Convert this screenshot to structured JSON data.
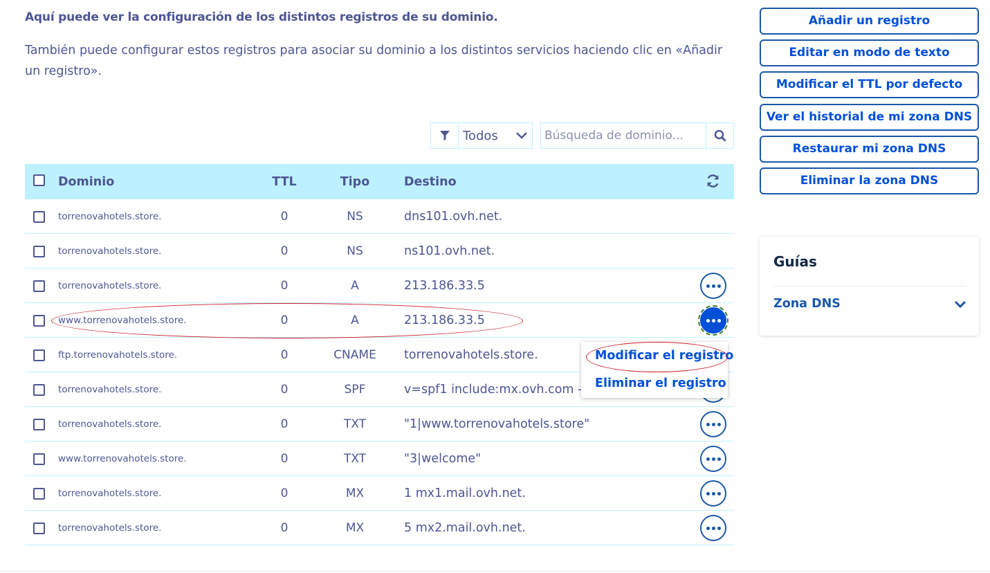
{
  "intro": {
    "title": "Aquí puede ver la configuración de los distintos registros de su dominio.",
    "text": "También puede configurar estos registros para asociar su dominio a los distintos servicios haciendo clic en «Añadir un registro»."
  },
  "filter": {
    "selected": "Todos",
    "icon": "filter-icon"
  },
  "search": {
    "placeholder": "Búsqueda de dominio...",
    "value": ""
  },
  "table": {
    "headers": {
      "domain": "Dominio",
      "ttl": "TTL",
      "type": "Tipo",
      "destination": "Destino"
    },
    "rows": [
      {
        "domain": "torrenovahotels.store.",
        "ttl": "0",
        "type": "NS",
        "destination": "dns101.ovh.net."
      },
      {
        "domain": "torrenovahotels.store.",
        "ttl": "0",
        "type": "NS",
        "destination": "ns101.ovh.net."
      },
      {
        "domain": "torrenovahotels.store.",
        "ttl": "0",
        "type": "A",
        "destination": "213.186.33.5"
      },
      {
        "domain": "www.torrenovahotels.store.",
        "ttl": "0",
        "type": "A",
        "destination": "213.186.33.5"
      },
      {
        "domain": "ftp.torrenovahotels.store.",
        "ttl": "0",
        "type": "CNAME",
        "destination": "torrenovahotels.store."
      },
      {
        "domain": "torrenovahotels.store.",
        "ttl": "0",
        "type": "SPF",
        "destination": "v=spf1 include:mx.ovh.com -all"
      },
      {
        "domain": "torrenovahotels.store.",
        "ttl": "0",
        "type": "TXT",
        "destination": "\"1|www.torrenovahotels.store\""
      },
      {
        "domain": "www.torrenovahotels.store.",
        "ttl": "0",
        "type": "TXT",
        "destination": "\"3|welcome\""
      },
      {
        "domain": "torrenovahotels.store.",
        "ttl": "0",
        "type": "MX",
        "destination": "1 mx1.mail.ovh.net."
      },
      {
        "domain": "torrenovahotels.store.",
        "ttl": "0",
        "type": "MX",
        "destination": "5 mx2.mail.ovh.net."
      }
    ]
  },
  "row_menu": {
    "edit": "Modificar el registro",
    "delete": "Eliminar el registro"
  },
  "actions": [
    "Añadir un registro",
    "Editar en modo de texto",
    "Modificar el TTL por defecto",
    "Ver el historial de mi zona DNS",
    "Restaurar mi zona DNS",
    "Eliminar la zona DNS"
  ],
  "guides": {
    "title": "Guías",
    "item": "Zona DNS"
  },
  "colors": {
    "text": "#4d5693",
    "accent": "#0050d7",
    "border": "#1957a8",
    "table_header_bg": "#bef1ff",
    "annotation": "#c9202a"
  }
}
